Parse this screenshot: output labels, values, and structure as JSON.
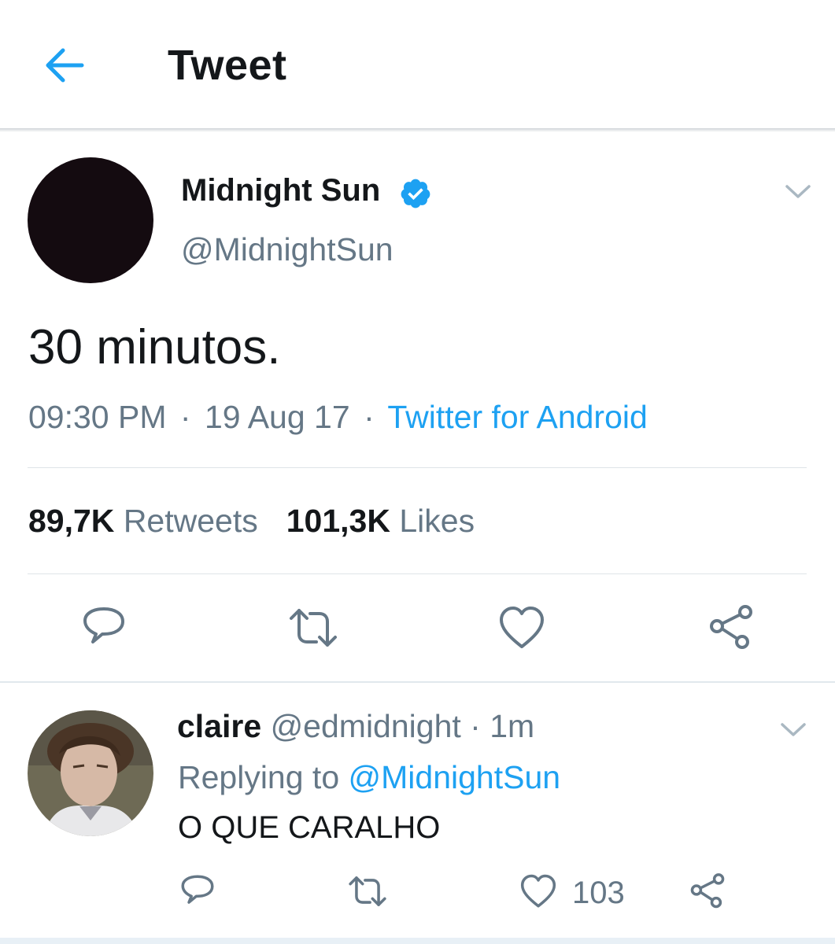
{
  "header": {
    "title": "Tweet",
    "back_icon": "arrow-left-icon"
  },
  "colors": {
    "accent": "#1da1f2",
    "text": "#14171a",
    "secondary": "#657786",
    "divider": "#e1e8ed"
  },
  "tweet": {
    "author": {
      "name": "Midnight Sun",
      "handle": "@MidnightSun",
      "verified": true
    },
    "text": "30 minutos.",
    "time": "09:30 PM",
    "date": "19 Aug 17",
    "source": "Twitter for Android",
    "separator": "·",
    "retweets_count": "89,7K",
    "retweets_label": "Retweets",
    "likes_count": "101,3K",
    "likes_label": "Likes",
    "actions": [
      "reply-icon",
      "retweet-icon",
      "like-icon",
      "share-icon"
    ]
  },
  "reply": {
    "author": {
      "name": "claire",
      "handle": "@edmidnight"
    },
    "time_sep": "·",
    "time": "1m",
    "replying_label": "Replying to",
    "replying_to": "@MidnightSun",
    "text": "O QUE CARALHO",
    "like_count": "103",
    "actions": [
      "reply-icon",
      "retweet-icon",
      "like-icon",
      "share-icon"
    ]
  }
}
